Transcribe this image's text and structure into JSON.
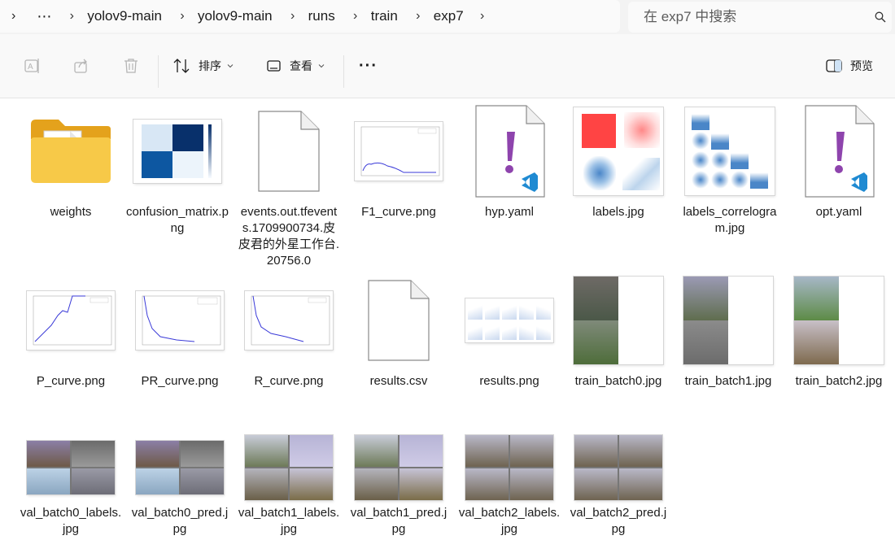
{
  "breadcrumb": {
    "more": "⋯",
    "items": [
      "yolov9-main",
      "yolov9-main",
      "runs",
      "train",
      "exp7"
    ]
  },
  "search": {
    "placeholder": "在 exp7 中搜索"
  },
  "toolbar": {
    "sort_label": "排序",
    "view_label": "查看",
    "more_label": "···",
    "preview_label": "预览"
  },
  "files": [
    {
      "name": "weights",
      "type": "folder"
    },
    {
      "name": "confusion_matrix.png",
      "type": "image"
    },
    {
      "name": "events.out.tfevents.1709900734.皮皮君的外星工作台.20756.0",
      "type": "file"
    },
    {
      "name": "F1_curve.png",
      "type": "image"
    },
    {
      "name": "hyp.yaml",
      "type": "yaml"
    },
    {
      "name": "labels.jpg",
      "type": "image"
    },
    {
      "name": "labels_correlogram.jpg",
      "type": "image"
    },
    {
      "name": "opt.yaml",
      "type": "yaml"
    },
    {
      "name": "P_curve.png",
      "type": "image"
    },
    {
      "name": "PR_curve.png",
      "type": "image"
    },
    {
      "name": "R_curve.png",
      "type": "image"
    },
    {
      "name": "results.csv",
      "type": "file"
    },
    {
      "name": "results.png",
      "type": "image"
    },
    {
      "name": "train_batch0.jpg",
      "type": "image"
    },
    {
      "name": "train_batch1.jpg",
      "type": "image"
    },
    {
      "name": "train_batch2.jpg",
      "type": "image"
    },
    {
      "name": "val_batch0_labels.jpg",
      "type": "image"
    },
    {
      "name": "val_batch0_pred.jpg",
      "type": "image"
    },
    {
      "name": "val_batch1_labels.jpg",
      "type": "image"
    },
    {
      "name": "val_batch1_pred.jpg",
      "type": "image"
    },
    {
      "name": "val_batch2_labels.jpg",
      "type": "image"
    },
    {
      "name": "val_batch2_pred.jpg",
      "type": "image"
    }
  ],
  "colors": {
    "accent": "#0067c0",
    "folder": "#f5c24a",
    "yaml_mark": "#8e44ad",
    "vscode": "#1f8ad2"
  }
}
